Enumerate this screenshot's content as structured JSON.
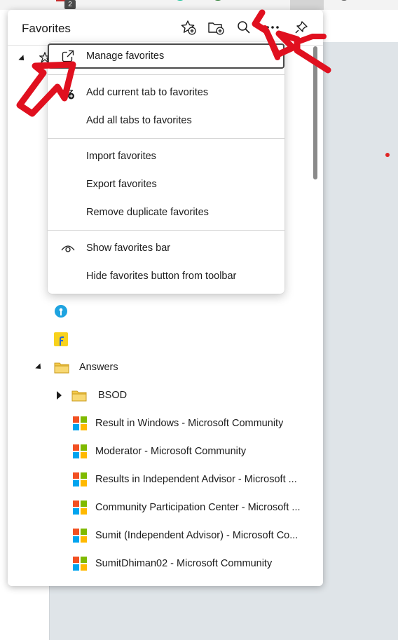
{
  "toolbar": {
    "badge_count": "2"
  },
  "panel": {
    "title": "Favorites",
    "header_buttons": [
      {
        "name": "add-this-page-icon"
      },
      {
        "name": "add-folder-icon"
      },
      {
        "name": "search-icon"
      },
      {
        "name": "more-options-icon"
      },
      {
        "name": "pin-icon"
      }
    ]
  },
  "menu": {
    "items": [
      {
        "label": "Manage favorites",
        "icon": "external-link-icon"
      },
      {
        "label": "Add current tab to favorites",
        "icon": "star-add-icon"
      },
      {
        "label": "Add all tabs to favorites",
        "icon": ""
      },
      {
        "label": "Import favorites",
        "icon": ""
      },
      {
        "label": "Export favorites",
        "icon": ""
      },
      {
        "label": "Remove duplicate favorites",
        "icon": ""
      },
      {
        "label": "Show favorites bar",
        "icon": "eye-icon"
      },
      {
        "label": "Hide favorites button from toolbar",
        "icon": ""
      }
    ]
  },
  "tree": {
    "folder": {
      "label": "Answers"
    },
    "subfolder": {
      "label": "BSOD"
    },
    "links": [
      {
        "label": "Result in Windows - Microsoft Community"
      },
      {
        "label": "Moderator - Microsoft Community"
      },
      {
        "label": "Results in Independent Advisor - Microsoft ..."
      },
      {
        "label": "Community Participation Center - Microsoft ..."
      },
      {
        "label": "Sumit (Independent Advisor) - Microsoft Co..."
      },
      {
        "label": "SumitDhiman02 - Microsoft Community"
      }
    ]
  },
  "colors": {
    "ms_red": "#f25022",
    "ms_green": "#7fba00",
    "ms_blue": "#00a4ef",
    "ms_yellow": "#ffb900",
    "folder_yellow": "#f4c94a",
    "annotation_red": "#e0101f"
  }
}
